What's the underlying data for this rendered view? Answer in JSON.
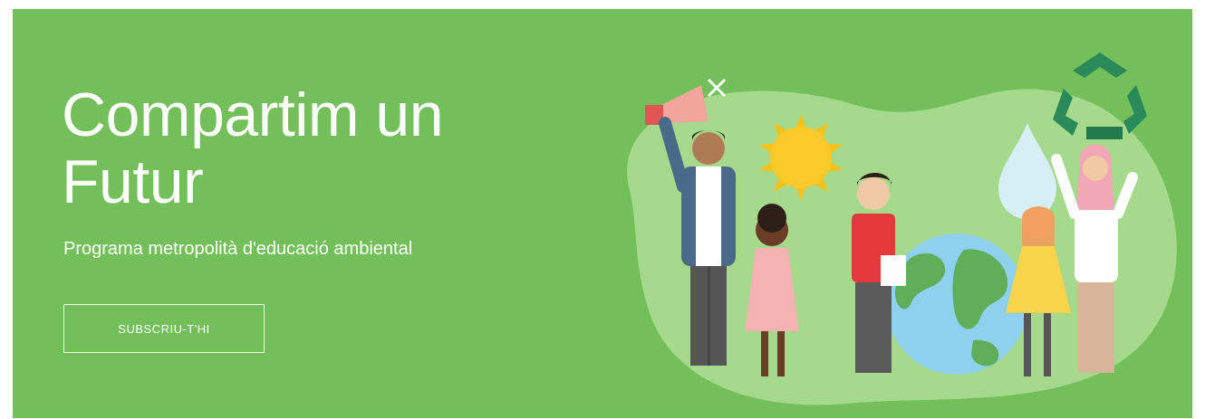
{
  "hero": {
    "title_line1": "Compartim un",
    "title_line2": "Futur",
    "subtitle": "Programa metropolità d'educació ambiental",
    "cta_label": "SUBSCRIU-T'HI"
  },
  "colors": {
    "banner_bg": "#73bf5a",
    "blob": "#a5d98b",
    "text": "#ffffff",
    "sun": "#f9c21b",
    "recycle": "#2a8a5a"
  },
  "illustration": {
    "icons": [
      "megaphone-icon",
      "sun-icon",
      "water-drop-icon",
      "recycle-icon",
      "earth-globe-icon"
    ]
  }
}
